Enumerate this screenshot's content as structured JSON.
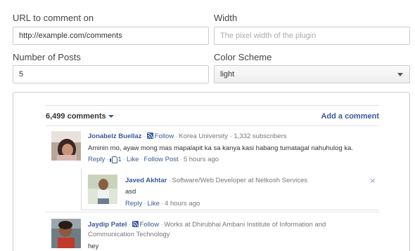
{
  "form": {
    "url_label": "URL to comment on",
    "url_value": "http://example.com/comments",
    "width_label": "Width",
    "width_placeholder": "The pixel width of the plugin",
    "posts_label": "Number of Posts",
    "posts_value": "5",
    "color_label": "Color Scheme",
    "color_value": "light"
  },
  "plugin": {
    "comment_count": "6,499 comments",
    "add_comment": "Add a comment",
    "comments": [
      {
        "name": "Jonabelz Buellaz",
        "follow": "Follow",
        "meta": "Korea University · 1,332 subscribers",
        "text": "Aminin mo, ayaw mong mas mapalapit ka sa kanya kasi habang tumatagal nahuhulog ka.",
        "reply": "Reply",
        "likes": "1",
        "like": "Like",
        "follow_post": "Follow Post",
        "time": "5 hours ago"
      },
      {
        "name": "Javed Akhtar",
        "meta": "Software/Web Developer at Netkosh Services",
        "text": "asd",
        "reply": "Reply",
        "like": "Like",
        "time": "4 hours ago"
      },
      {
        "name": "Jaydip Patel",
        "follow": "Follow",
        "meta_line1": "Works at Dhirubhai Ambani Institute of Information and",
        "meta_line2": "Communication Technology",
        "text": "hey"
      }
    ],
    "close_symbol": "×"
  },
  "colors": {
    "link": "#3b5998",
    "border": "#cccccc"
  }
}
